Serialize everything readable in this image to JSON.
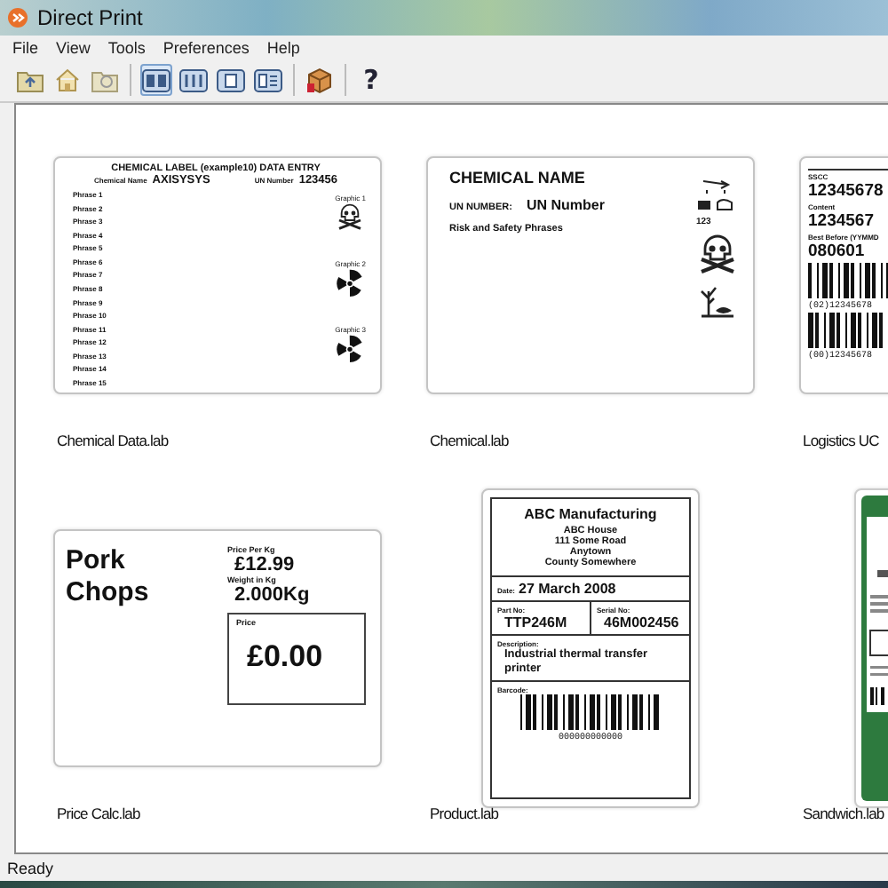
{
  "window": {
    "title": "Direct Print"
  },
  "menu": [
    "File",
    "View",
    "Tools",
    "Preferences",
    "Help"
  ],
  "toolbar": [
    {
      "kind": "up-folder"
    },
    {
      "kind": "home"
    },
    {
      "kind": "folder"
    },
    {
      "kind": "separator"
    },
    {
      "kind": "view-large",
      "selected": true
    },
    {
      "kind": "view-list",
      "selected": false
    },
    {
      "kind": "view-small",
      "selected": false
    },
    {
      "kind": "view-details",
      "selected": false
    },
    {
      "kind": "separator"
    },
    {
      "kind": "package"
    },
    {
      "kind": "separator"
    },
    {
      "kind": "help",
      "label": "?"
    }
  ],
  "labels": [
    {
      "kind": "chemical-data",
      "file": "Chemical Data.lab",
      "title": "CHEMICAL LABEL (example10) DATA ENTRY",
      "name_label": "Chemical Name",
      "name": "AXISYSYS",
      "un_label": "UN Number",
      "un": "123456",
      "phrases": [
        "Phrase 1",
        "Phrase 2",
        "Phrase 3",
        "Phrase 4",
        "Phrase 5",
        "Phrase 6",
        "Phrase 7",
        "Phrase 8",
        "Phrase 9",
        "Phrase 10",
        "Phrase 11",
        "Phrase 12",
        "Phrase 13",
        "Phrase 14",
        "Phrase 15"
      ],
      "graphics": [
        {
          "caption": "Graphic 1",
          "kind": "skull"
        },
        {
          "caption": "Graphic 2",
          "kind": "radiation"
        },
        {
          "caption": "Graphic 3",
          "kind": "radiation"
        }
      ]
    },
    {
      "kind": "chemical",
      "file": "Chemical.lab",
      "title": "CHEMICAL NAME",
      "un_label": "UN NUMBER:",
      "un": "UN Number",
      "phrases": "Risk and Safety Phrases",
      "code": "123"
    },
    {
      "kind": "logistics",
      "file": "Logistics UC",
      "fields": [
        {
          "label": "SSCC",
          "value": "12345678"
        },
        {
          "label": "Content",
          "value": "1234567"
        },
        {
          "label": "Best Before (YYMMD",
          "value": "080601"
        }
      ],
      "barcodes": [
        "(02)12345678",
        "(00)12345678"
      ]
    },
    {
      "kind": "price",
      "file": "Price Calc.lab",
      "name": "Pork Chops",
      "per_kg_label": "Price Per Kg",
      "per_kg": "£12.99",
      "weight_label": "Weight in Kg",
      "weight": "2.000Kg",
      "price_label": "Price",
      "price": "£0.00"
    },
    {
      "kind": "product",
      "file": "Product.lab",
      "company": "ABC Manufacturing",
      "address": [
        "ABC House",
        "111 Some Road",
        "Anytown",
        "County Somewhere"
      ],
      "date_label": "Date:",
      "date": "27 March 2008",
      "part_label": "Part No:",
      "part": "TTP246M",
      "serial_label": "Serial No:",
      "serial": "46M002456",
      "desc_label": "Description:",
      "desc": "Industrial thermal transfer printer",
      "barcode_label": "Barcode:",
      "barcode_number": "000000000000"
    },
    {
      "kind": "sandwich",
      "file": "Sandwich.lab"
    }
  ],
  "status_bar": "Ready"
}
